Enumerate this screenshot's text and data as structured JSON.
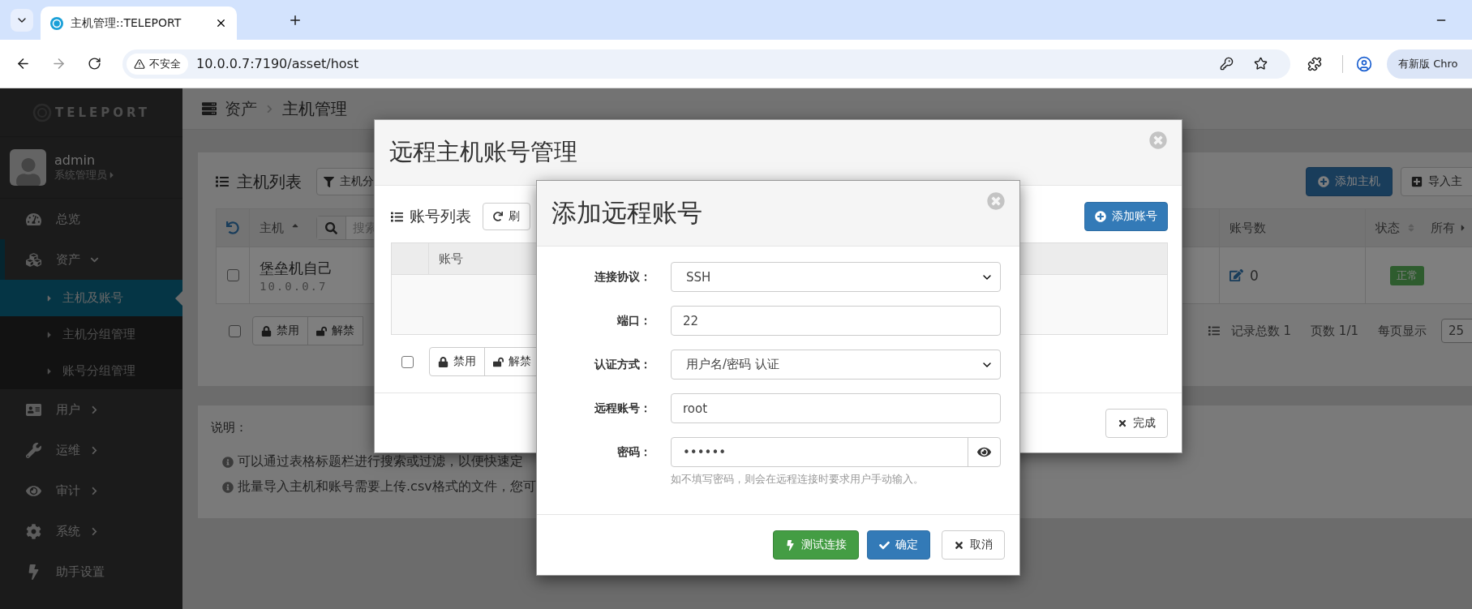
{
  "browser": {
    "tab_title": "主机管理::TELEPORT",
    "security_label": "不安全",
    "url": "10.0.0.7:7190/asset/host",
    "update_chip": "有新版 Chro"
  },
  "sidebar": {
    "logo": "TELEPORT",
    "user": {
      "name": "admin",
      "role": "系统管理员"
    },
    "items": [
      {
        "label": "总览",
        "selected": false
      },
      {
        "label": "资产",
        "selected": false,
        "expanded": true,
        "children": [
          {
            "label": "主机及账号",
            "selected": true
          },
          {
            "label": "主机分组管理",
            "selected": false
          },
          {
            "label": "账号分组管理",
            "selected": false
          }
        ]
      },
      {
        "label": "用户",
        "selected": false,
        "expanded": false
      },
      {
        "label": "运维",
        "selected": false,
        "expanded": false
      },
      {
        "label": "审计",
        "selected": false,
        "expanded": false
      },
      {
        "label": "系统",
        "selected": false,
        "expanded": false
      },
      {
        "label": "助手设置",
        "selected": false
      }
    ]
  },
  "breadcrumb": [
    "资产",
    "主机管理"
  ],
  "host_panel": {
    "title": "主机列表",
    "filter_button": "主机分",
    "buttons": [
      {
        "label": "添加主机",
        "kind": "primary"
      },
      {
        "label": "导入主",
        "kind": "default"
      }
    ],
    "columns": [
      {
        "label": "主机",
        "sorted": true,
        "placeholder": "搜索"
      },
      {
        "label": "账号数"
      },
      {
        "label": "状态",
        "sorted": false,
        "filter": "所有"
      }
    ],
    "rows": [
      {
        "name": "堡垒机自己",
        "ip": "10.0.0.7",
        "accounts": "0",
        "status": "正常",
        "checked": false
      }
    ],
    "footer_checked": false,
    "actions": [
      "禁用",
      "解禁"
    ],
    "pagination": {
      "total": "记录总数 1",
      "pages": "页数 1/1",
      "per_page_label": "每页显示",
      "per_page": "25"
    }
  },
  "notes": {
    "title": "说明：",
    "items": [
      "可以通过表格标题栏进行搜索或过滤，以便快速定",
      "批量导入主机和账号需要上传.csv格式的文件，您可"
    ]
  },
  "account_dialog": {
    "title": "远程主机账号管理",
    "list_title": "账号列表",
    "refresh_button": "刷",
    "add_button": "添加账号",
    "columns": [
      "账号"
    ],
    "footer_checked": false,
    "actions": [
      "禁用",
      "解禁"
    ],
    "done_button": "完成"
  },
  "add_dialog": {
    "title": "添加远程账号",
    "fields": [
      {
        "label": "连接协议：",
        "kind": "select",
        "value": "SSH"
      },
      {
        "label": "端口：",
        "kind": "text",
        "value": "22"
      },
      {
        "label": "认证方式：",
        "kind": "select",
        "value": "用户名/密码 认证"
      },
      {
        "label": "远程账号：",
        "kind": "text",
        "value": "root"
      },
      {
        "label": "密码：",
        "kind": "password",
        "value": "••••••",
        "hint": "如不填写密码，则会在远程连接时要求用户手动输入。"
      }
    ],
    "buttons": [
      {
        "label": "测试连接",
        "kind": "success"
      },
      {
        "label": "确定",
        "kind": "primary"
      },
      {
        "label": "取消",
        "kind": "default"
      }
    ]
  }
}
